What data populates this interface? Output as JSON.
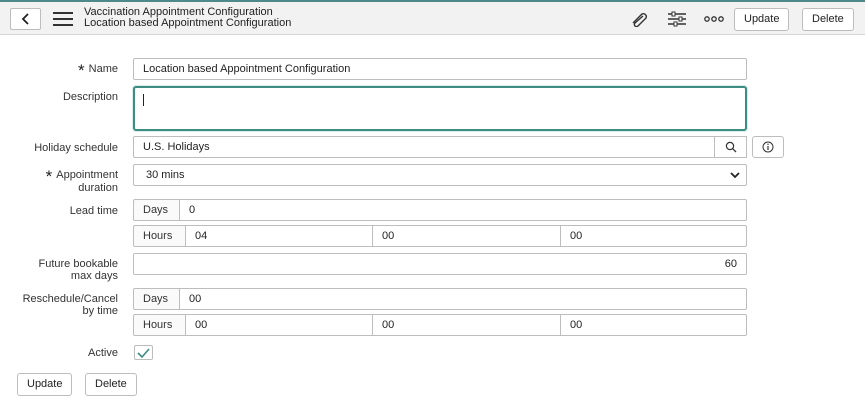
{
  "header": {
    "title": "Vaccination Appointment Configuration",
    "subtitle": "Location based Appointment Configuration",
    "update_label": "Update",
    "delete_label": "Delete"
  },
  "form": {
    "name": {
      "label": "Name",
      "value": "Location based Appointment Configuration",
      "required": true
    },
    "description": {
      "label": "Description",
      "value": ""
    },
    "holiday_schedule": {
      "label": "Holiday schedule",
      "value": "U.S. Holidays"
    },
    "appointment_duration": {
      "label_line1": "Appointment",
      "label_line2": "duration",
      "value": "30 mins",
      "required": true
    },
    "lead_time": {
      "label": "Lead time",
      "days_label": "Days",
      "days": "0",
      "hours_label": "Hours",
      "hours": "04",
      "minutes": "00",
      "seconds": "00"
    },
    "future_bookable": {
      "label_line1": "Future bookable",
      "label_line2": "max days",
      "value": "60"
    },
    "reschedule_cancel": {
      "label_line1": "Reschedule/Cancel",
      "label_line2": "by time",
      "days_label": "Days",
      "days": "00",
      "hours_label": "Hours",
      "hours": "00",
      "minutes": "00",
      "seconds": "00"
    },
    "active": {
      "label": "Active",
      "checked": true
    }
  },
  "footer": {
    "update_label": "Update",
    "delete_label": "Delete"
  },
  "icons": {
    "back": "chevron-left-icon",
    "menu": "hamburger-menu-icon",
    "attachment": "paperclip-icon",
    "personalize": "sliders-icon",
    "more": "more-options-icon",
    "lookup": "search-icon",
    "info": "info-icon",
    "dropdown": "chevron-down-icon",
    "check": "checkmark-icon"
  },
  "colors": {
    "accent": "#3e8d83",
    "header_bg": "#f2f2f2"
  }
}
